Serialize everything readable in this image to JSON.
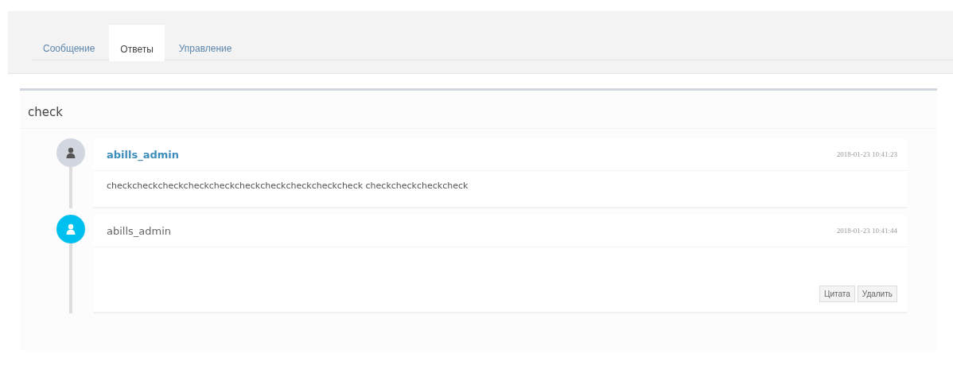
{
  "tabs": [
    {
      "label": "Сообщение",
      "selected": false
    },
    {
      "label": "Ответы",
      "selected": true
    },
    {
      "label": "Управление",
      "selected": false
    }
  ],
  "subject": "check",
  "replies": [
    {
      "kind": "link",
      "color": "#d2d6de",
      "author": "abills_admin",
      "time": "2018-01-23 10:41:23",
      "text": "checkcheckcheckcheckcheckcheckcheckcheckcheckcheck checkcheckcheckcheck"
    },
    {
      "kind": "plain",
      "color": "#00c0ef",
      "author": "abills_admin",
      "time": "2018-01-23 10:41:44",
      "buttons": [
        "Цитата",
        "Удалить"
      ]
    }
  ]
}
